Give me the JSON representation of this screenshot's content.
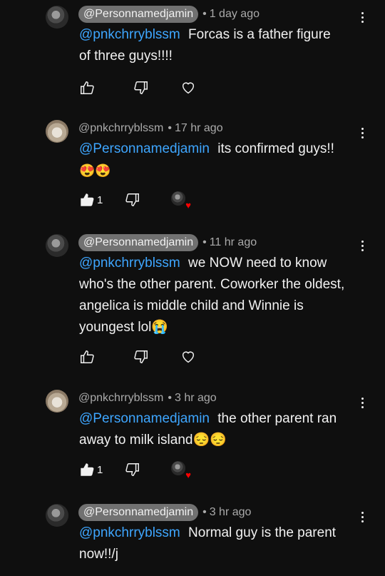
{
  "comments": [
    {
      "handle": "@Personnamedjamin",
      "time": "1 day ago",
      "mention": "@pnkchrryblssm",
      "text_lines": [
        "Forcas is a father figure",
        "of three guys!!!!"
      ],
      "like_count": "",
      "avatar": "dark",
      "pill": true,
      "heart": false
    },
    {
      "handle": "@pnkchrryblssm",
      "time": "17 hr ago",
      "mention": "@Personnamedjamin",
      "text_lines": [
        "its confirmed guys!!",
        "😍😍"
      ],
      "like_count": "1",
      "avatar": "cat",
      "pill": false,
      "heart": true
    },
    {
      "handle": "@Personnamedjamin",
      "time": "11 hr ago",
      "mention": "@pnkchrryblssm",
      "text_lines": [
        "we NOW need to know",
        "who's the other parent. Coworker the oldest,",
        "angelica is middle child and Winnie is",
        "youngest lol😭"
      ],
      "like_count": "",
      "avatar": "dark",
      "pill": true,
      "heart": false
    },
    {
      "handle": "@pnkchrryblssm",
      "time": "3 hr ago",
      "mention": "@Personnamedjamin",
      "text_lines": [
        "the other parent ran",
        "away to milk island😔😔"
      ],
      "like_count": "1",
      "avatar": "cat",
      "pill": false,
      "heart": true
    },
    {
      "handle": "@Personnamedjamin",
      "time": "3 hr ago",
      "mention": "@pnkchrryblssm",
      "text_lines": [
        "Normal guy is the parent",
        "now!!/j"
      ],
      "like_count": "",
      "avatar": "dark",
      "pill": true,
      "heart": false
    }
  ],
  "separator": "•",
  "icons": {
    "like": "thumbs-up-icon",
    "dislike": "thumbs-down-icon",
    "heart": "heart-icon",
    "menu": "more-vert-icon"
  },
  "colors": {
    "background": "#0f0f0f",
    "mention": "#3ea6ff",
    "pill": "#717171",
    "heart_red": "#ff0000"
  }
}
